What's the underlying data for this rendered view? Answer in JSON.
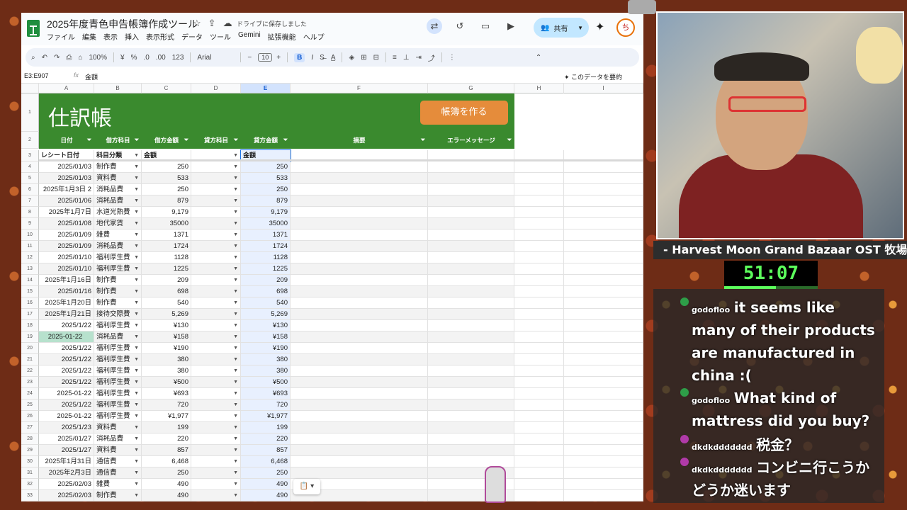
{
  "doc": {
    "title": "2025年度青色申告帳簿作成ツール",
    "save_status": "ドライブに保存しました",
    "menu": [
      "ファイル",
      "編集",
      "表示",
      "挿入",
      "表示形式",
      "データ",
      "ツール",
      "Gemini",
      "拡張機能",
      "ヘルプ"
    ],
    "share_label": "共有",
    "avatar_letter": "ち"
  },
  "toolbar": {
    "zoom": "100%",
    "currency": "¥",
    "percent": "%",
    "dec_dec": ".0",
    "dec_inc": ".00",
    "num_fmt": "123",
    "font": "Arial",
    "font_size": "10",
    "bold": "B",
    "italic": "I"
  },
  "formula_bar": {
    "name_box": "E3:E907",
    "fx": "fx",
    "value": "金額",
    "summarize_label": "このデータを要約"
  },
  "columns": [
    "A",
    "B",
    "C",
    "D",
    "E",
    "F",
    "G",
    "H",
    "I"
  ],
  "sheet": {
    "banner_title": "仕訳帳",
    "make_button": "帳簿を作る",
    "headers": [
      "日付",
      "借方科目",
      "借方金額",
      "貸方科目",
      "貸方金額",
      "摘要",
      "エラーメッセージ"
    ],
    "subheader": {
      "a": "レシート日付",
      "b": "科目分類",
      "c": "金額",
      "e": "金額"
    },
    "rows": [
      [
        "4",
        "2025/01/03",
        "制作費",
        "250",
        "250"
      ],
      [
        "5",
        "2025/01/03",
        "資料費",
        "533",
        "533"
      ],
      [
        "6",
        "2025年1月3日 2",
        "消耗品費",
        "250",
        "250"
      ],
      [
        "7",
        "2025/01/06",
        "消耗品費",
        "879",
        "879"
      ],
      [
        "8",
        "2025年1月7日",
        "水道光熱費",
        "9,179",
        "9,179"
      ],
      [
        "9",
        "2025/01/08",
        "地代家賃",
        "35000",
        "35000"
      ],
      [
        "10",
        "2025/01/09",
        "雑費",
        "1371",
        "1371"
      ],
      [
        "11",
        "2025/01/09",
        "消耗品費",
        "1724",
        "1724"
      ],
      [
        "12",
        "2025/01/10",
        "福利厚生費",
        "1128",
        "1128"
      ],
      [
        "13",
        "2025/01/10",
        "福利厚生費",
        "1225",
        "1225"
      ],
      [
        "14",
        "2025年1月16日",
        "制作費",
        "209",
        "209"
      ],
      [
        "15",
        "2025/01/16",
        "制作費",
        "698",
        "698"
      ],
      [
        "16",
        "2025年1月20日",
        "制作費",
        "540",
        "540"
      ],
      [
        "17",
        "2025年1月21日",
        "接待交際費",
        "5,269",
        "5,269"
      ],
      [
        "18",
        "2025/1/22",
        "福利厚生費",
        "¥130",
        "¥130"
      ],
      [
        "19",
        "2025-01-22",
        "消耗品費",
        "¥158",
        "¥158"
      ],
      [
        "20",
        "2025/1/22",
        "福利厚生費",
        "¥190",
        "¥190"
      ],
      [
        "21",
        "2025/1/22",
        "福利厚生費",
        "380",
        "380"
      ],
      [
        "22",
        "2025/1/22",
        "福利厚生費",
        "380",
        "380"
      ],
      [
        "23",
        "2025/1/22",
        "福利厚生費",
        "¥500",
        "¥500"
      ],
      [
        "24",
        "2025-01-22",
        "福利厚生費",
        "¥693",
        "¥693"
      ],
      [
        "25",
        "2025/1/22",
        "福利厚生費",
        "720",
        "720"
      ],
      [
        "26",
        "2025-01-22",
        "福利厚生費",
        "¥1,977",
        "¥1,977"
      ],
      [
        "27",
        "2025/1/23",
        "資料費",
        "199",
        "199"
      ],
      [
        "28",
        "2025/01/27",
        "消耗品費",
        "220",
        "220"
      ],
      [
        "29",
        "2025/1/27",
        "資料費",
        "857",
        "857"
      ],
      [
        "30",
        "2025年1月31日",
        "通信費",
        "6,468",
        "6,468"
      ],
      [
        "31",
        "2025年2月3日",
        "通信費",
        "250",
        "250"
      ],
      [
        "32",
        "2025/02/03",
        "雑費",
        "490",
        "490"
      ],
      [
        "33",
        "2025/02/03",
        "制作費",
        "490",
        "490"
      ]
    ]
  },
  "stream": {
    "song": "- Harvest Moon Grand Bazaar OST 牧場",
    "timer": "51:07",
    "timer_progress": 0.55,
    "chat": [
      {
        "name": "godofloo",
        "text": "it seems like many of their products are manufactured in china :(",
        "color": "#2e9e48"
      },
      {
        "name": "godofloo",
        "text": "What kind of mattress did you buy?",
        "color": "#2e9e48"
      },
      {
        "name": "dkdkddddddd",
        "text": "税金？",
        "color": "#b03aa8"
      },
      {
        "name": "dkdkddddddd",
        "text": "コンビニ行こうかどうか迷います",
        "color": "#b03aa8"
      }
    ]
  }
}
